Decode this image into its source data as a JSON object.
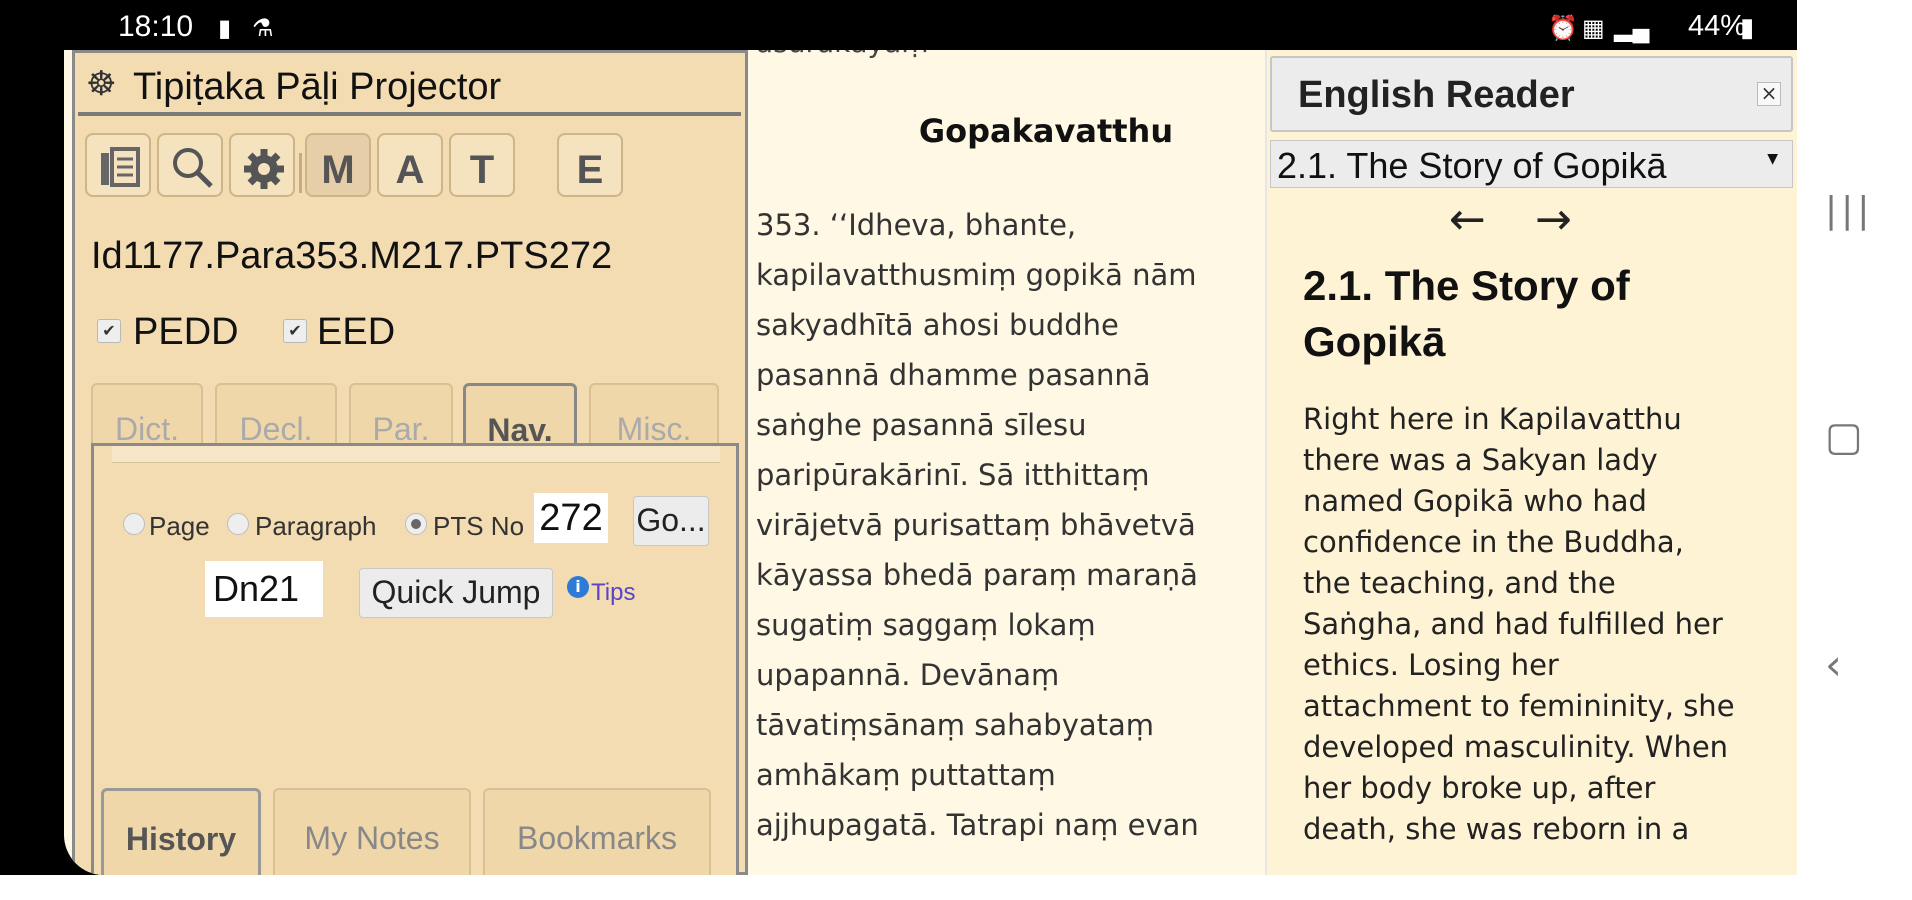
{
  "status_bar": {
    "time": "18:10",
    "battery": "44%"
  },
  "app": {
    "title": "Tipiṭaka Pāḷi Projector"
  },
  "toolbar": {
    "m_label": "M",
    "a_label": "A",
    "t_label": "T",
    "e_label": "E"
  },
  "location_id": "Id1177.Para353.M217.PTS272",
  "checkboxes": [
    {
      "label": "PEDD",
      "checked": true
    },
    {
      "label": "EED",
      "checked": true
    }
  ],
  "tabs": [
    {
      "label": "Dict."
    },
    {
      "label": "Decl."
    },
    {
      "label": "Par."
    },
    {
      "label": "Nav."
    },
    {
      "label": "Misc."
    }
  ],
  "nav": {
    "radios": [
      {
        "label": "Page"
      },
      {
        "label": "Paragraph"
      },
      {
        "label": "PTS No"
      }
    ],
    "pts_value": "272",
    "go_label": "Go...",
    "jump_value": "Dn21",
    "quick_jump_label": "Quick Jump",
    "tips_label": "Tips"
  },
  "bottom_tabs": [
    {
      "label": "History"
    },
    {
      "label": "My Notes"
    },
    {
      "label": "Bookmarks"
    }
  ],
  "pali": {
    "top_cut": "asurakāyaṃ",
    "heading": "Gopakavatthu",
    "lines": [
      " 353. ‘‘Idheva, bhante,",
      "kapilavatthusmiṃ gopikā nām",
      "sakyadhītā ahosi buddhe",
      "pasannā dhamme pasannā",
      "saṅghe pasannā sīlesu",
      "paripūrakārinī. Sā itthittaṃ",
      "virājetvā purisattaṃ bhāvetvā",
      "kāyassa bhedā paraṃ maraṇā",
      "sugatiṃ saggaṃ lokaṃ",
      "upapannā. Devānaṃ",
      "tāvatiṃsānaṃ sahabyataṃ",
      "amhākaṃ puttattaṃ",
      "ajjhupagatā. Tatrapi naṃ evan"
    ]
  },
  "reader": {
    "title": "English Reader",
    "close": "×",
    "selected": "2.1. The Story of Gopikā",
    "back_arrow": "←",
    "forward_arrow": "→",
    "heading": "2.1. The Story of Gopikā",
    "lines": [
      "Right here in Kapilavatthu",
      "there was a Sakyan lady",
      "named Gopikā who had",
      "confidence in the Buddha,",
      "the teaching, and the",
      "Saṅgha, and had fulfilled her",
      "ethics. Losing her",
      "attachment to femininity, she",
      "developed masculinity. When",
      "her body broke up, after",
      "death, she was reborn in a"
    ]
  }
}
